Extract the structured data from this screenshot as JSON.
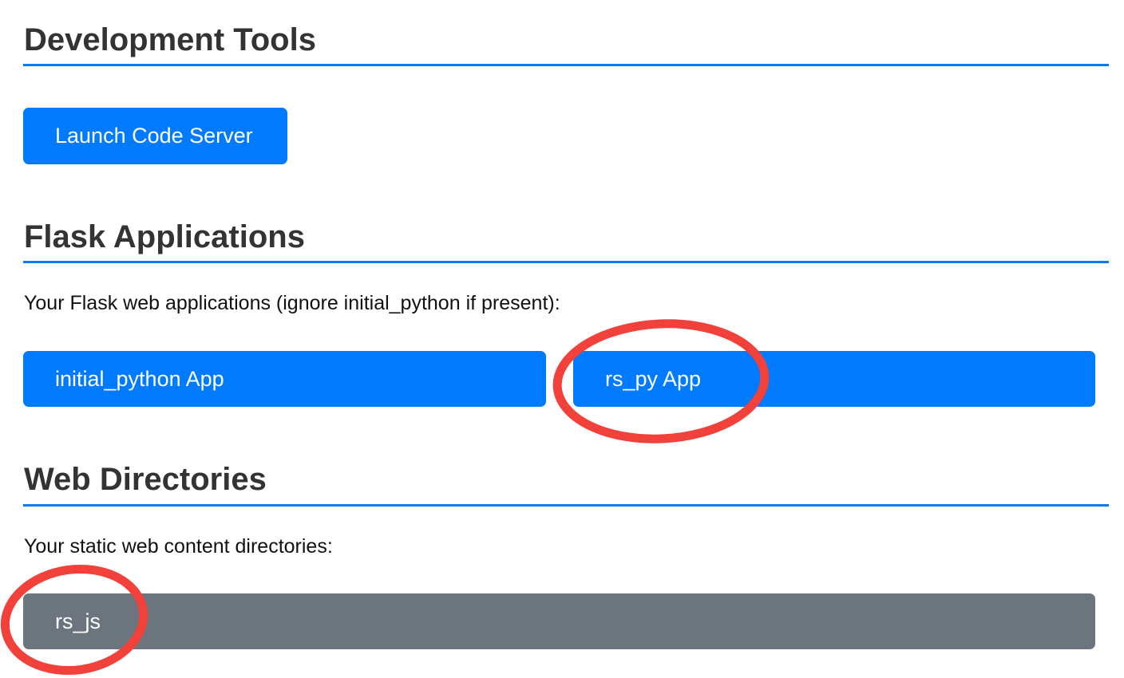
{
  "sections": {
    "dev_tools": {
      "title": "Development Tools",
      "button_label": "Launch Code Server"
    },
    "flask": {
      "title": "Flask Applications",
      "description": "Your Flask web applications (ignore initial_python if present):",
      "apps": [
        {
          "label": "initial_python App"
        },
        {
          "label": "rs_py App"
        }
      ]
    },
    "web_dirs": {
      "title": "Web Directories",
      "description": "Your static web content directories:",
      "dirs": [
        {
          "label": "rs_js"
        }
      ]
    }
  },
  "colors": {
    "primary": "#007bff",
    "secondary": "#6c757d",
    "rule": "#0a7cf0",
    "annotation": "#f2413a"
  }
}
